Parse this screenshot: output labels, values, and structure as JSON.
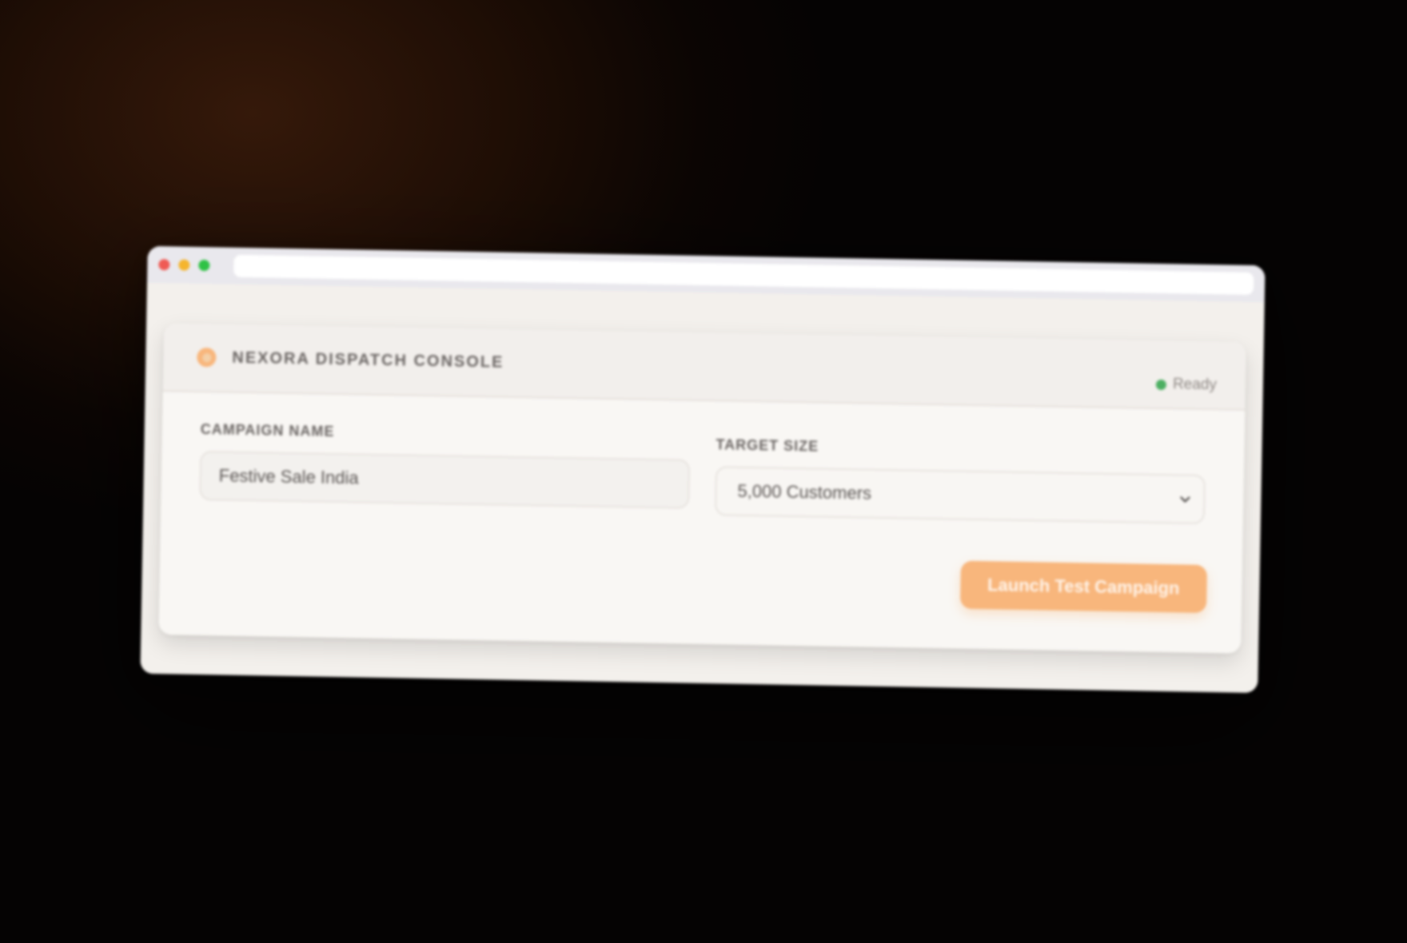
{
  "window": {
    "controls": [
      {
        "name": "close",
        "color": "#ef5b55"
      },
      {
        "name": "minimize",
        "color": "#f5b52e"
      },
      {
        "name": "maximize",
        "color": "#2fc245"
      }
    ],
    "address_bar_value": ""
  },
  "header": {
    "brand": "NEXORA DISPATCH CONSOLE",
    "status_text": "Ready",
    "status_color": "#4caf62",
    "logo_icon": "logo-icon"
  },
  "form": {
    "campaign_name": {
      "label": "CAMPAIGN NAME",
      "value": "Festive Sale India"
    },
    "target_size": {
      "label": "TARGET SIZE",
      "selected": "5,000 Customers",
      "chevron_icon": "chevron-down-icon"
    }
  },
  "actions": {
    "launch_label": "Launch Test Campaign",
    "accent_color": "#f8b67c"
  }
}
